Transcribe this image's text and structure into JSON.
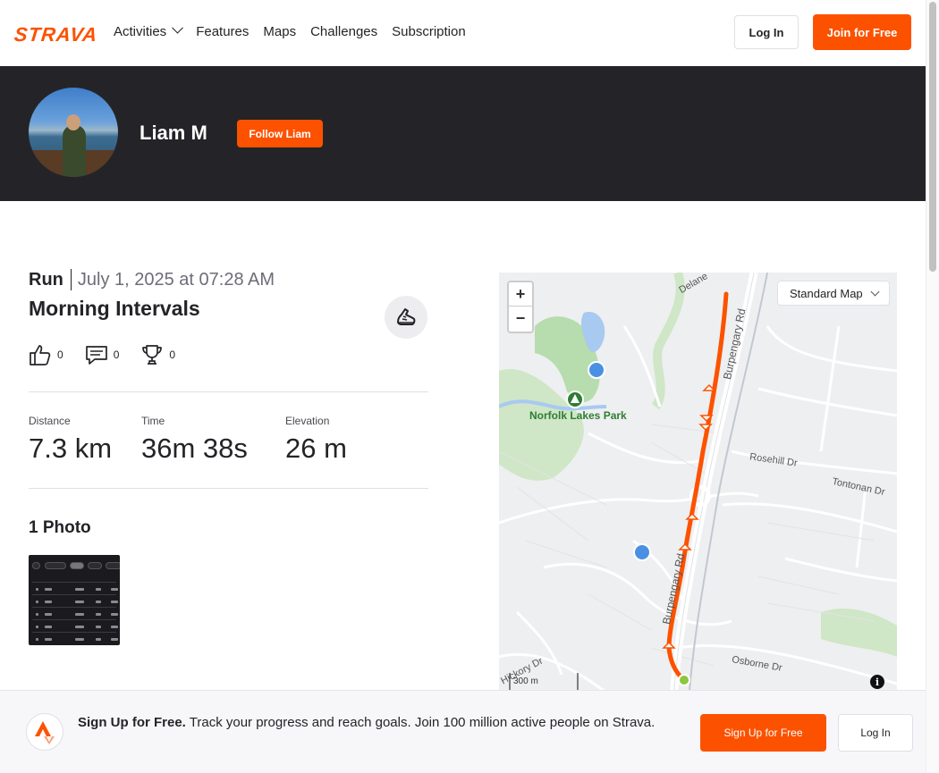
{
  "header": {
    "logo": "STRAVA",
    "nav": [
      {
        "label": "Activities",
        "has_dropdown": true
      },
      {
        "label": "Features"
      },
      {
        "label": "Maps"
      },
      {
        "label": "Challenges"
      },
      {
        "label": "Subscription"
      }
    ],
    "login_label": "Log In",
    "join_label": "Join for Free"
  },
  "profile": {
    "name": "Liam M",
    "follow_label": "Follow Liam"
  },
  "activity": {
    "type": "Run",
    "date": "July 1, 2025 at 07:28 AM",
    "title": "Morning Intervals",
    "sport_icon": "running-shoe-icon",
    "kudos": "0",
    "comments": "0",
    "achievements": "0",
    "stats": [
      {
        "label": "Distance",
        "value": "7.3 km"
      },
      {
        "label": "Time",
        "value": "36m 38s"
      },
      {
        "label": "Elevation",
        "value": "26 m"
      }
    ],
    "photos_title": "1 Photo"
  },
  "map": {
    "zoom_in": "+",
    "zoom_out": "−",
    "style_select": "Standard Map",
    "scale": "300 m",
    "labels": {
      "park": "Norfolk Lakes Park",
      "road1": "Burpengary Rd",
      "road2": "Burpengary Rd",
      "rosehill": "Rosehill Dr",
      "tontonan": "Tontonan Dr",
      "osborne": "Osborne Dr",
      "hickory": "Hickory Dr",
      "delaney": "Delane"
    },
    "colors": {
      "route": "#fc5200",
      "water": "#a8c9f0",
      "park": "#b7dcae",
      "road": "#ffffff"
    }
  },
  "signup": {
    "headline": "Sign Up for Free.",
    "body": "Track your progress and reach goals. Join 100 million active people on Strava.",
    "signup_label": "Sign Up for Free",
    "login_label": "Log In"
  },
  "colors": {
    "brand": "#fc5200",
    "banner": "#242428"
  }
}
